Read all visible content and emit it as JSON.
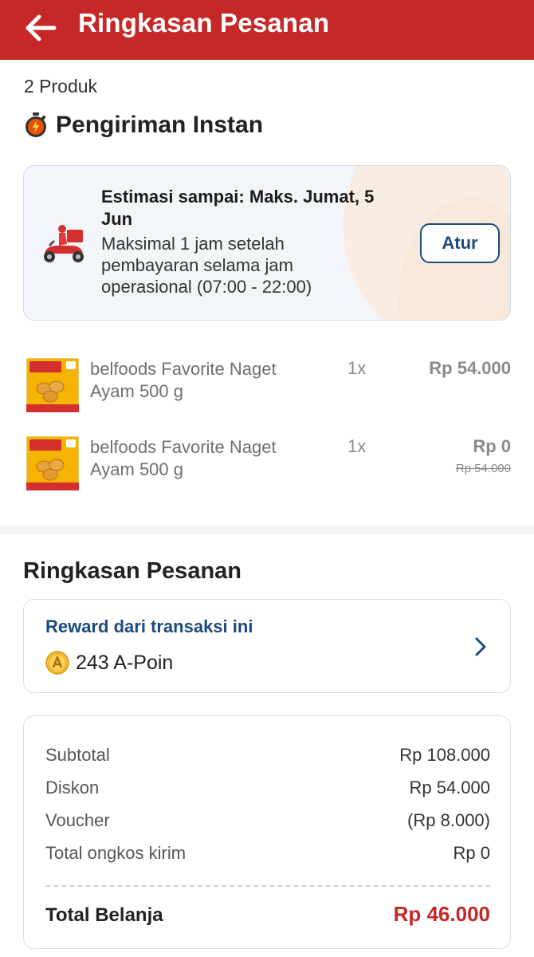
{
  "header": {
    "title": "Ringkasan Pesanan",
    "back_icon": "arrow-left-icon"
  },
  "colors": {
    "brand": "#c62828",
    "link": "#1b4a7d",
    "total": "#c62828"
  },
  "order": {
    "product_count": "2 Produk",
    "delivery_type": "Pengiriman Instan",
    "estimate": {
      "title": "Estimasi sampai: Maks. Jumat, 5 Jun",
      "description": "Maksimal 1 jam setelah pembayaran selama jam operasional (07:00 - 22:00)",
      "button": "Atur"
    },
    "items": [
      {
        "name": "belfoods Favorite Naget Ayam 500 g",
        "qty": "1x",
        "price": "Rp 54.000",
        "original_price": ""
      },
      {
        "name": "belfoods Favorite Naget Ayam 500 g",
        "qty": "1x",
        "price": "Rp 0",
        "original_price": "Rp 54.000"
      }
    ]
  },
  "summary": {
    "title": "Ringkasan Pesanan",
    "reward": {
      "label": "Reward dari transaksi ini",
      "points": "243 A-Poin"
    },
    "rows": [
      {
        "label": "Subtotal",
        "value": "Rp 108.000"
      },
      {
        "label": "Diskon",
        "value": "Rp 54.000"
      },
      {
        "label": "Voucher",
        "value": "(Rp 8.000)"
      },
      {
        "label": "Total ongkos kirim",
        "value": "Rp 0"
      }
    ],
    "total": {
      "label": "Total Belanja",
      "value": "Rp 46.000"
    }
  }
}
